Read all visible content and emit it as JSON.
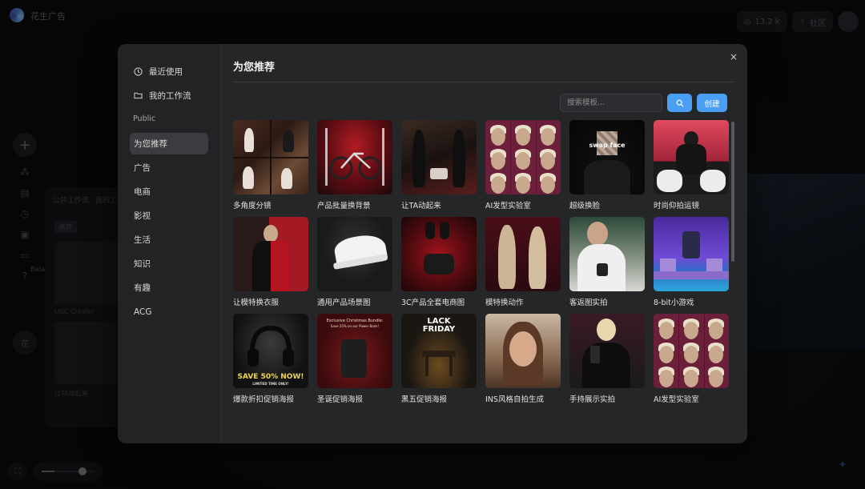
{
  "app": {
    "name": "花生广告",
    "stats": "13.2 k",
    "community": "社区",
    "rail_badge": "Beta",
    "rail_avatar": "花"
  },
  "background_panel": {
    "tabs": [
      "公共工作流",
      "我的工"
    ],
    "chip": "推荐",
    "card1_caption": "UGC Creator",
    "card2_caption": "让TA动起来"
  },
  "modal": {
    "title": "为您推荐",
    "close_label": "×",
    "sidebar": {
      "recent": "最近使用",
      "my_workflows": "我的工作流",
      "section": "Public",
      "categories": [
        "为您推荐",
        "广告",
        "电商",
        "影视",
        "生活",
        "知识",
        "有趣",
        "ACG"
      ],
      "active_index": 0
    },
    "search": {
      "placeholder": "搜索模板...",
      "value": "",
      "create_label": "创建"
    },
    "templates": [
      {
        "label": "多角度分镜"
      },
      {
        "label": "产品批量换背景"
      },
      {
        "label": "让TA动起来"
      },
      {
        "label": "AI发型实验室"
      },
      {
        "label": "超级换脸",
        "overlay": "swap face"
      },
      {
        "label": "时尚仰拍运镜"
      },
      {
        "label": "让模特换衣服"
      },
      {
        "label": "通用产品场景图"
      },
      {
        "label": "3C产品全套电商图"
      },
      {
        "label": "模特换动作"
      },
      {
        "label": "客返图实拍"
      },
      {
        "label": "8-bit小游戏"
      },
      {
        "label": "爆款折扣促销海报",
        "overlay": "SAVE 50% NOW!",
        "overlay_sub": "LIMITED TIME ONLY!"
      },
      {
        "label": "圣诞促销海报",
        "overlay": "Exclusive Christmas Bundle:",
        "overlay_sub": "Save 25% on our Power Bank!"
      },
      {
        "label": "黑五促销海报",
        "overlay": "LACK",
        "overlay_sub": "FRIDAY"
      },
      {
        "label": "INS风格自拍生成"
      },
      {
        "label": "手持展示实拍"
      },
      {
        "label": "AI发型实验室"
      }
    ]
  },
  "colors": {
    "accent": "#4a9ff5",
    "modal_bg": "#252628",
    "active_item": "#3b3c3f"
  }
}
